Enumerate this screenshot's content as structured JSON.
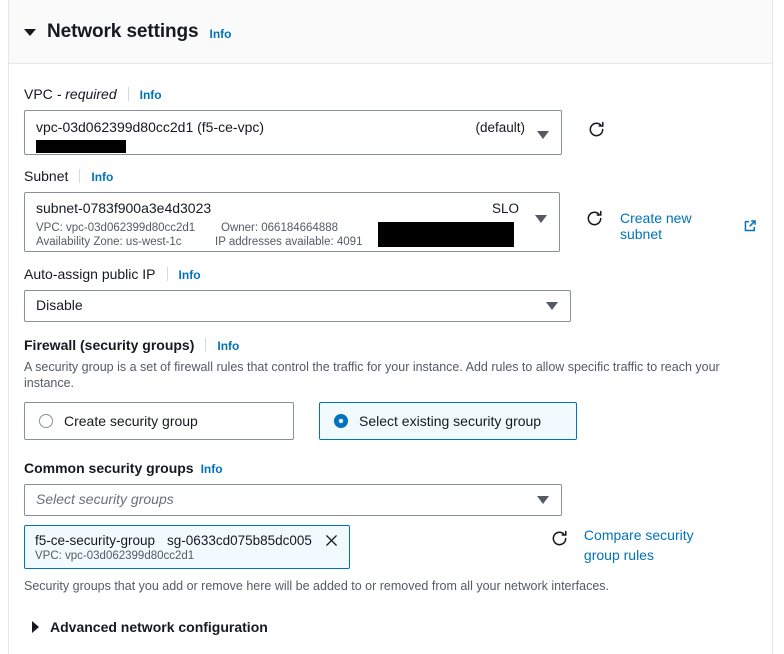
{
  "section": {
    "title": "Network settings",
    "info_label": "Info",
    "expanded": true
  },
  "vpc": {
    "label": "VPC",
    "required_suffix": "- required",
    "info_label": "Info",
    "value": "vpc-03d062399d80cc2d1 (f5-ce-vpc)",
    "right_tag": "(default)",
    "refresh_icon": "refresh-icon",
    "caret_icon": "chevron-down-icon"
  },
  "subnet": {
    "label": "Subnet",
    "info_label": "Info",
    "value": "subnet-0783f900a3e4d3023",
    "right_tag": "SLO",
    "meta_vpc": "VPC: vpc-03d062399d80cc2d1",
    "meta_owner": "Owner: 066184664888",
    "meta_az": "Availability Zone: us-west-1c",
    "meta_ips": "IP addresses available: 4091",
    "create_link": "Create new subnet",
    "external_icon": "external-link-icon",
    "refresh_icon": "refresh-icon"
  },
  "auto_assign_ip": {
    "label": "Auto-assign public IP",
    "info_label": "Info",
    "value": "Disable"
  },
  "firewall": {
    "label": "Firewall (security groups)",
    "info_label": "Info",
    "description": "A security group is a set of firewall rules that control the traffic for your instance. Add rules to allow specific traffic to reach your instance.",
    "options": [
      {
        "label": "Create security group",
        "selected": false
      },
      {
        "label": "Select existing security group",
        "selected": true
      }
    ]
  },
  "common_security_groups": {
    "label": "Common security groups",
    "info_label": "Info",
    "placeholder": "Select security groups",
    "selected_tokens": [
      {
        "name": "f5-ce-security-group",
        "id": "sg-0633cd075b85dc005",
        "vpc": "VPC: vpc-03d062399d80cc2d1",
        "remove_icon": "close-icon"
      }
    ],
    "compare_link_line1": "Compare security",
    "compare_link_line2": "group rules",
    "refresh_icon": "refresh-icon",
    "footnote": "Security groups that you add or remove here will be added to or removed from all your network interfaces."
  },
  "advanced": {
    "label": "Advanced network configuration",
    "expanded": false
  },
  "colors": {
    "accent_blue": "#0073bb",
    "border_gray": "#879196",
    "text_dark": "#16191f",
    "text_muted": "#545b64",
    "selected_fill": "#f1faff",
    "header_band": "#fafafa"
  }
}
